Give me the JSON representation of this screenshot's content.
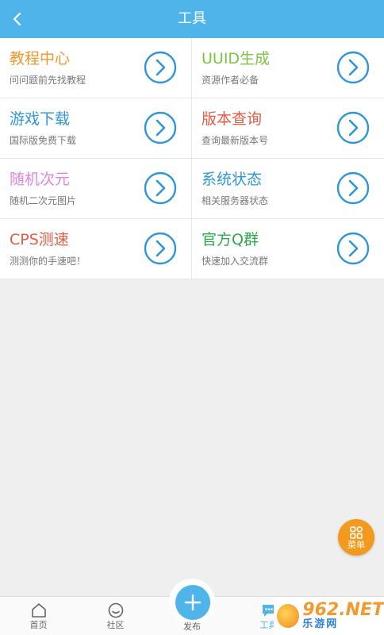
{
  "header": {
    "title": "工具"
  },
  "tools": [
    {
      "title": "教程中心",
      "subtitle": "问问题前先找教程",
      "color": "#f0962b"
    },
    {
      "title": "UUID生成",
      "subtitle": "资源作者必备",
      "color": "#7dc242"
    },
    {
      "title": "游戏下载",
      "subtitle": "国际版免费下载",
      "color": "#2f95d6"
    },
    {
      "title": "版本查询",
      "subtitle": "查询最新版本号",
      "color": "#e35b43"
    },
    {
      "title": "随机次元",
      "subtitle": "随机二次元图片",
      "color": "#e383e0"
    },
    {
      "title": "系统状态",
      "subtitle": "相关服务器状态",
      "color": "#2f95d6"
    },
    {
      "title": "CPS测速",
      "subtitle": "测测你的手速吧！",
      "color": "#e35b43"
    },
    {
      "title": "官方Q群",
      "subtitle": "快速加入交流群",
      "color": "#2aa84a"
    }
  ],
  "menu_fab": {
    "label": "菜单"
  },
  "tabbar": {
    "home": "首页",
    "community": "社区",
    "publish": "发布",
    "tools": "工具"
  },
  "watermark": {
    "main": "962.NET",
    "sub": "乐游网"
  },
  "colors": {
    "accent": "#4fb4ea",
    "arrow": "#2f95d6",
    "fab": "#f39a1e"
  }
}
